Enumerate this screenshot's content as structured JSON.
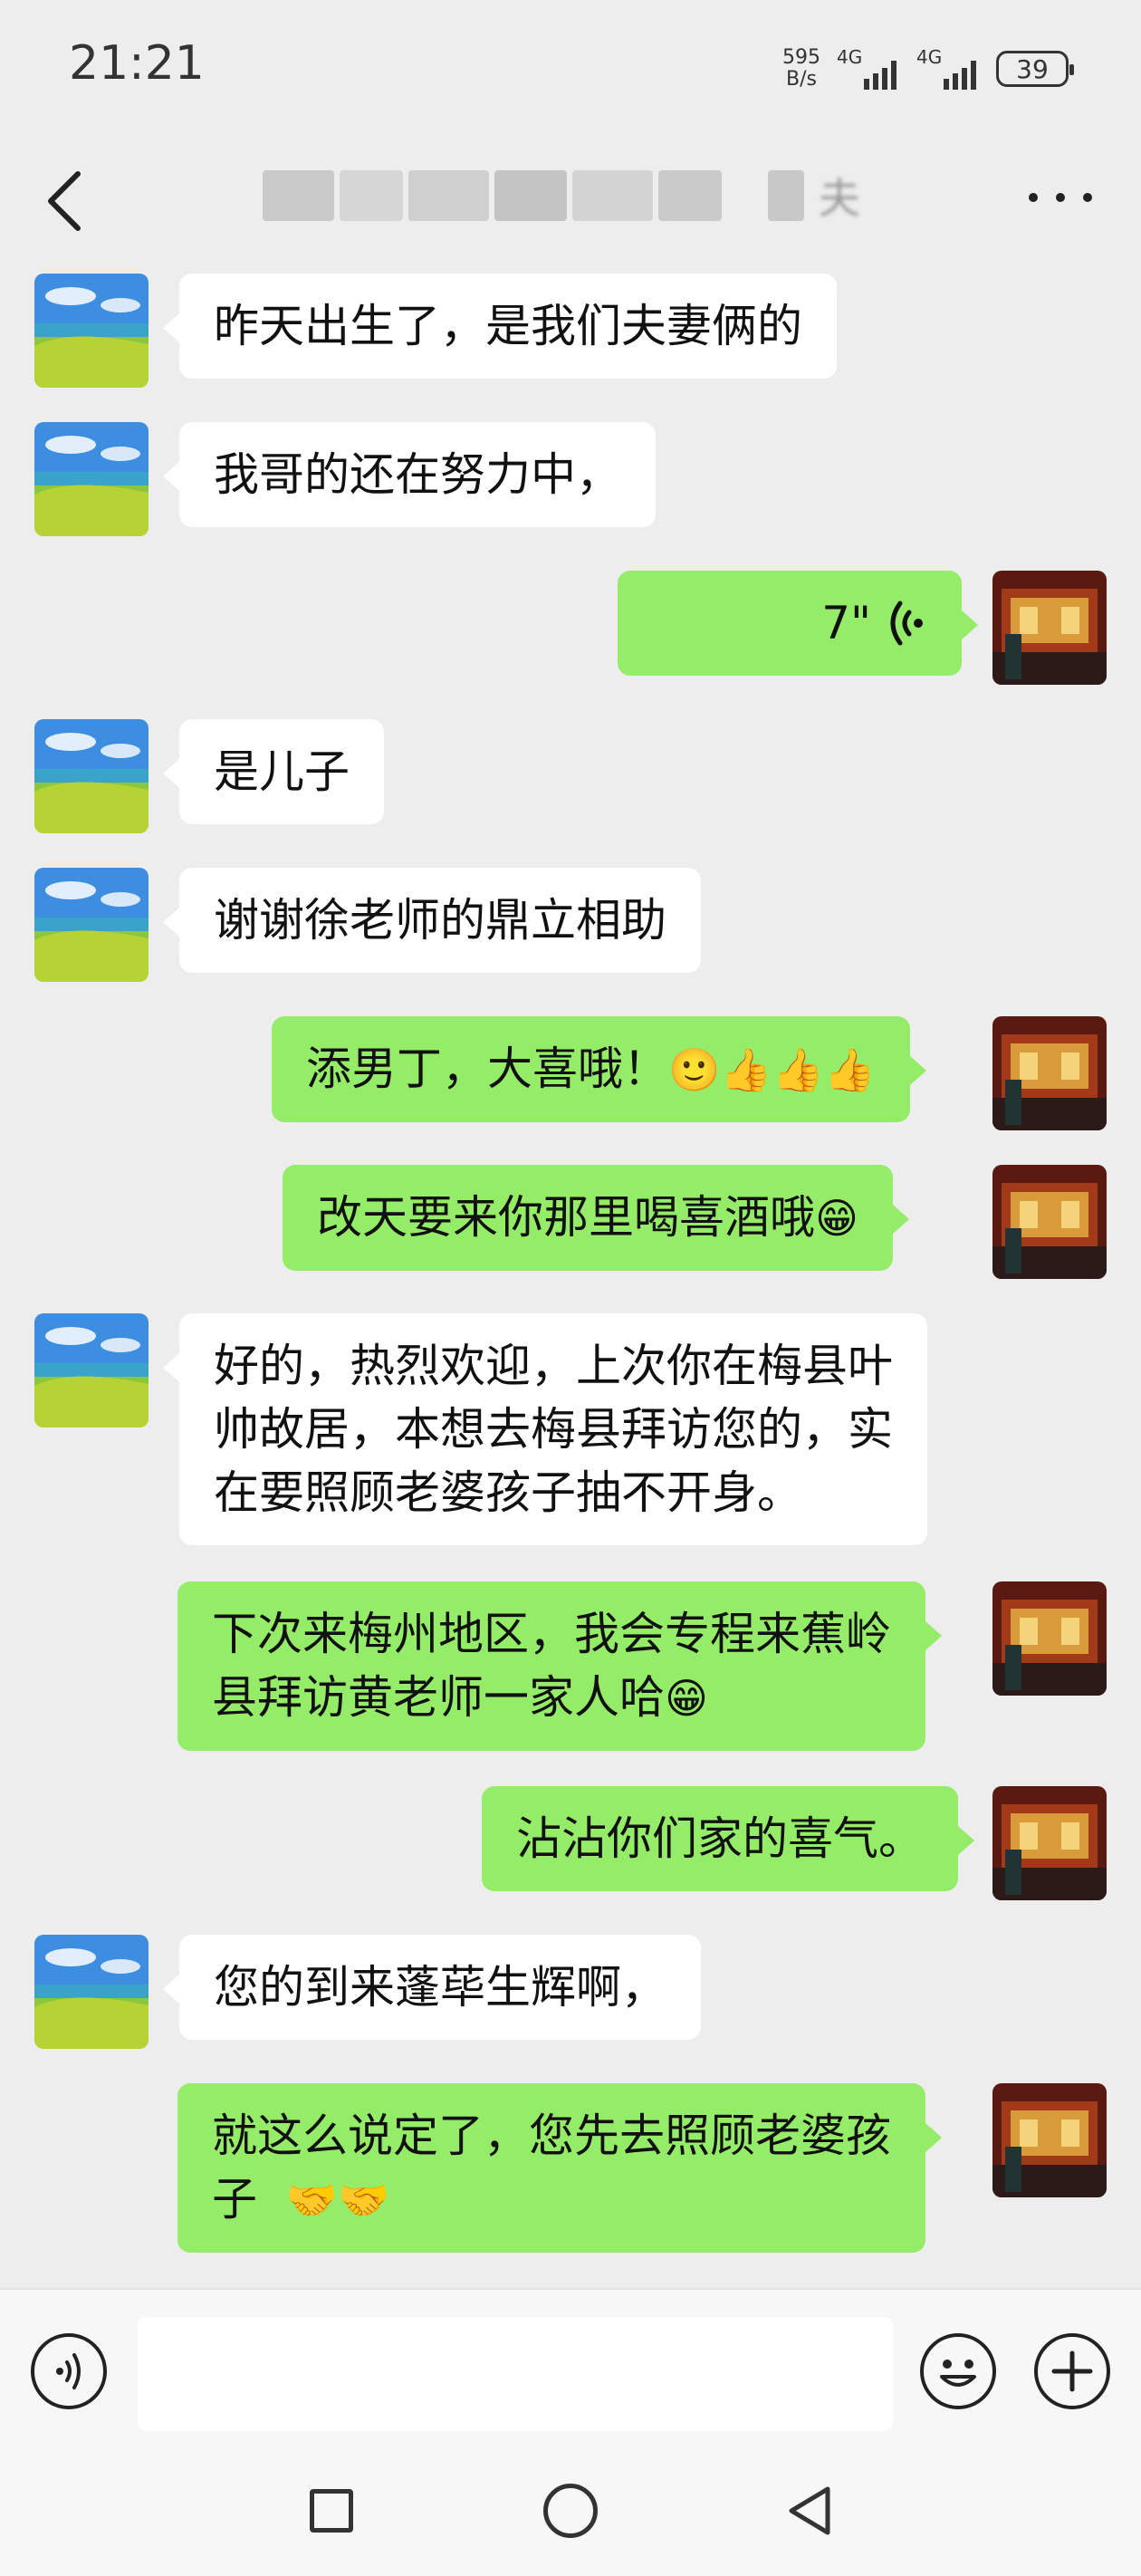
{
  "status_bar": {
    "time": "21:21",
    "net_speed_value": "595",
    "net_speed_unit": "B/s",
    "signal1_label": "4G",
    "signal2_label": "4G",
    "battery": "39"
  },
  "header": {
    "title_fragment": "夫"
  },
  "messages": [
    {
      "side": "in",
      "type": "text",
      "text": "昨天出生了，是我们夫妻俩的"
    },
    {
      "side": "in",
      "type": "text",
      "text": "我哥的还在努力中，"
    },
    {
      "side": "out",
      "type": "voice",
      "duration": "7\""
    },
    {
      "side": "in",
      "type": "text",
      "text": "是儿子"
    },
    {
      "side": "in",
      "type": "text",
      "text": "谢谢徐老师的鼎立相助"
    },
    {
      "side": "out",
      "type": "text",
      "text": "添男丁，大喜哦！",
      "emoji": "🙂👍👍👍"
    },
    {
      "side": "out",
      "type": "text",
      "text": "改天要来你那里喝喜酒哦",
      "emoji": "😁"
    },
    {
      "side": "in",
      "type": "text",
      "lines": [
        "好的，热烈欢迎，上次你在梅县叶",
        "帅故居，本想去梅县拜访您的，实",
        "在要照顾老婆孩子抽不开身。"
      ]
    },
    {
      "side": "out",
      "type": "text",
      "lines": [
        "下次来梅州地区，我会专程来蕉岭",
        "县拜访黄老师一家人哈"
      ],
      "emoji": "😁"
    },
    {
      "side": "out",
      "type": "text",
      "text": "沾沾你们家的喜气。"
    },
    {
      "side": "in",
      "type": "text",
      "text": "您的到来蓬荜生辉啊，"
    },
    {
      "side": "out",
      "type": "text",
      "lines": [
        "就这么说定了，您先去照顾老婆孩",
        "子"
      ],
      "emoji": "🤝🤝"
    }
  ],
  "colors": {
    "background": "#ededed",
    "incoming_bubble": "#ffffff",
    "outgoing_bubble": "#95ec69"
  }
}
